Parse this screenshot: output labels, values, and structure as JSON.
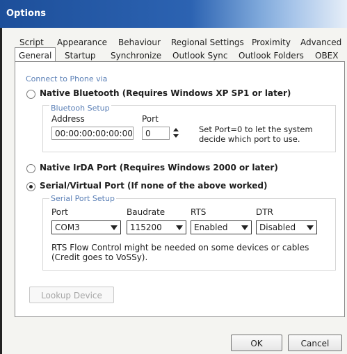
{
  "window": {
    "title": "Options"
  },
  "tabs_row1": [
    "Script",
    "Appearance",
    "Behaviour",
    "Regional Settings",
    "Proximity",
    "Advanced"
  ],
  "tabs_row2": [
    "General",
    "Startup",
    "Synchronize",
    "Outlook Sync",
    "Outlook Folders",
    "OBEX"
  ],
  "active_tab": "General",
  "connect_group": {
    "title": "Connect to Phone via"
  },
  "bluetooth": {
    "label": "Native Bluetooth (Requires Windows XP SP1 or later)",
    "checked": false,
    "setup_title": "Bluetooh Setup",
    "address_label": "Address",
    "address_value": "00:00:00:00:00:00",
    "port_label": "Port",
    "port_value": "0",
    "port_note": "Set Port=0 to let the system decide which port to use."
  },
  "irda": {
    "label": "Native IrDA Port (Requires Windows 2000 or later)",
    "checked": false
  },
  "serial": {
    "label": "Serial/Virtual Port (If none of the above worked)",
    "checked": true,
    "setup_title": "Serial Port Setup",
    "port_label": "Port",
    "port_value": "COM3",
    "baud_label": "Baudrate",
    "baud_value": "115200",
    "rts_label": "RTS",
    "rts_value": "Enabled",
    "dtr_label": "DTR",
    "dtr_value": "Disabled",
    "note": "RTS Flow Control might be needed on some devices or cables (Credit goes to VoSSy)."
  },
  "lookup_button": "Lookup Device",
  "ok_button": "OK",
  "cancel_button": "Cancel"
}
